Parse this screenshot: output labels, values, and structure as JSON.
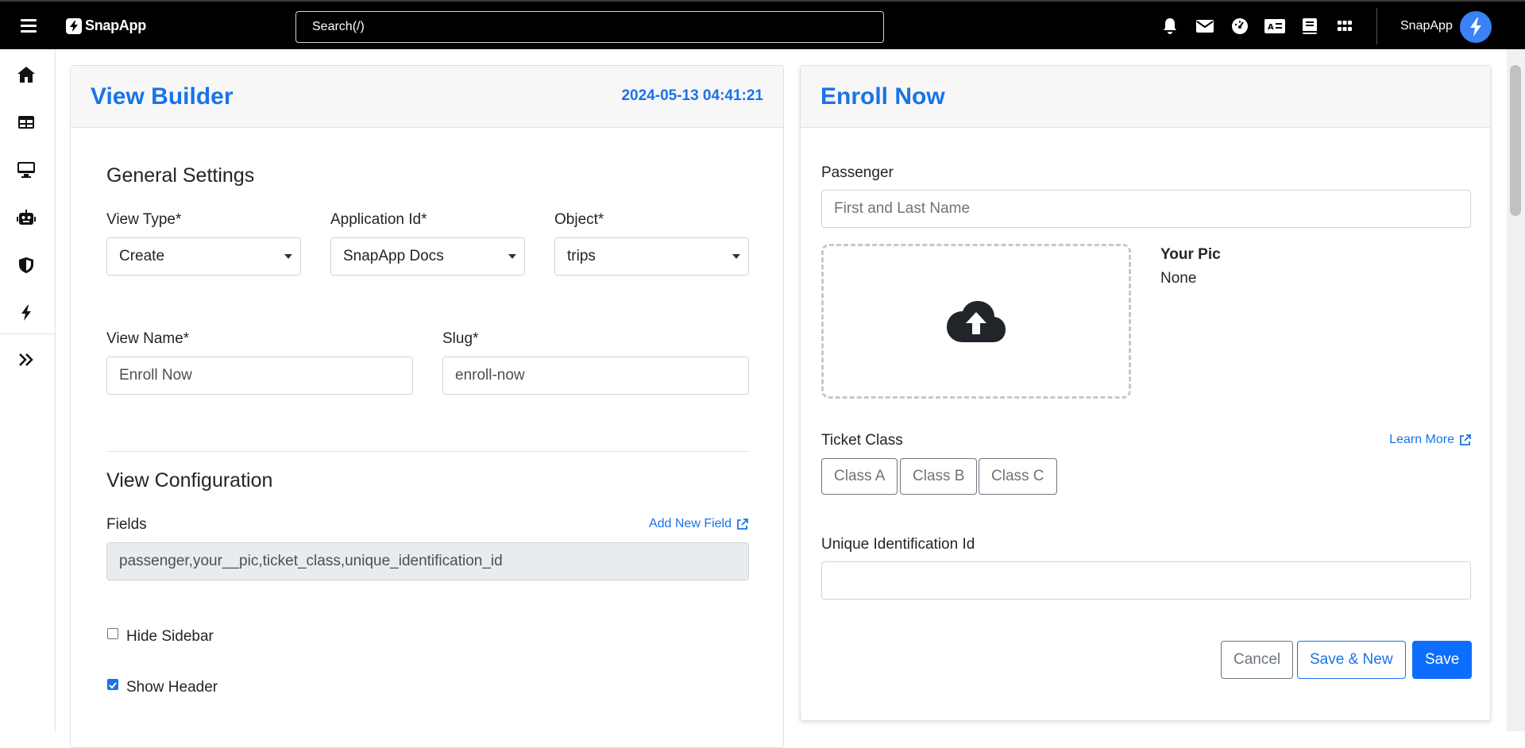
{
  "topbar": {
    "brand": "SnapApp",
    "search_placeholder": "Search(/)",
    "user_name": "SnapApp",
    "icons": [
      "bell-icon",
      "mail-icon",
      "dashboard-gauge-icon",
      "id-card-icon",
      "book-icon",
      "grid-apps-icon"
    ]
  },
  "sidebar": {
    "icons": [
      "home-icon",
      "table-icon",
      "monitor-icon",
      "robot-icon",
      "shield-icon",
      "bolt-icon",
      "double-chevron-right-icon"
    ]
  },
  "builder": {
    "title": "View Builder",
    "timestamp": "2024-05-13 04:41:21",
    "general_title": "General Settings",
    "view_type_label": "View Type*",
    "view_type_value": "Create",
    "app_id_label": "Application Id*",
    "app_id_value": "SnapApp Docs",
    "object_label": "Object*",
    "object_value": "trips",
    "view_name_label": "View Name*",
    "view_name_value": "Enroll Now",
    "slug_label": "Slug*",
    "slug_value": "enroll-now",
    "config_title": "View Configuration",
    "fields_label": "Fields",
    "add_field_link": "Add New Field",
    "fields_value": "passenger,your__pic,ticket_class,unique_identification_id",
    "hide_sidebar_label": "Hide Sidebar",
    "hide_sidebar_checked": false,
    "show_header_label": "Show Header",
    "show_header_checked": true
  },
  "preview": {
    "title": "Enroll Now",
    "passenger_label": "Passenger",
    "passenger_placeholder": "First and Last Name",
    "pic_label": "Your Pic",
    "pic_value": "None",
    "ticket_label": "Ticket Class",
    "learn_more": "Learn More",
    "classes": [
      "Class A",
      "Class B",
      "Class C"
    ],
    "uid_label": "Unique Identification Id",
    "uid_value": "",
    "cancel": "Cancel",
    "save_new": "Save & New",
    "save": "Save"
  },
  "colors": {
    "accent": "#1a73e8",
    "primary_button": "#0d6efd"
  }
}
